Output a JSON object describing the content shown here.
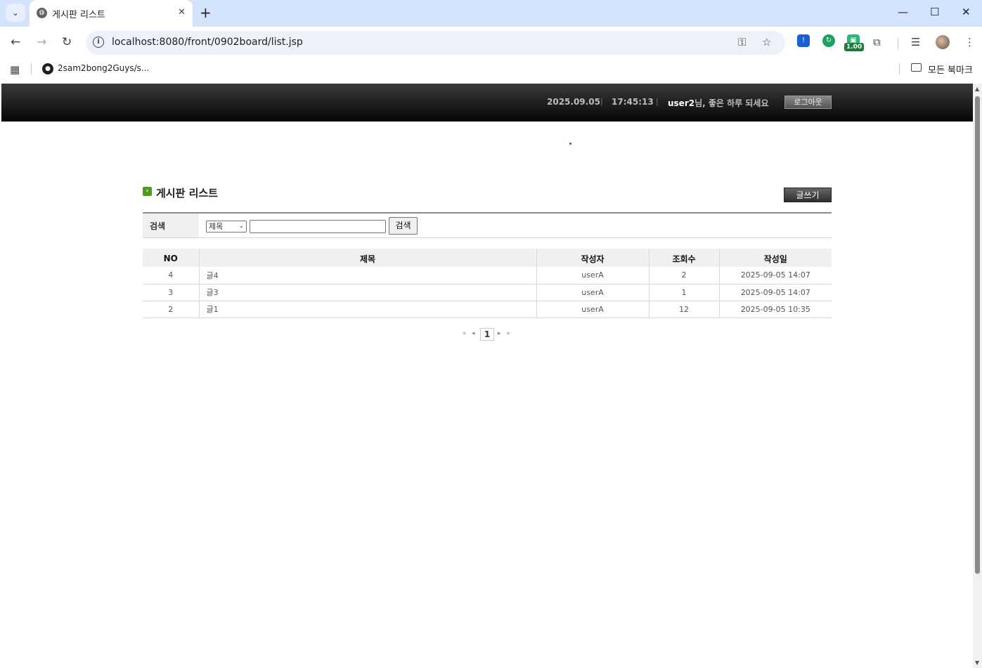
{
  "browser": {
    "tab_title": "게시판 리스트",
    "url": "localhost:8080/front/0902board/list.jsp",
    "bookmark_label": "2sam2bong2Guys/s...",
    "all_bookmarks_label": "모든 북마크",
    "extension_badge": "1.00"
  },
  "header": {
    "date": "2025.09.05",
    "time": "17:45:13",
    "username": "user2",
    "greeting": "님, 좋은 하루 되세요",
    "logout_label": "로그아웃"
  },
  "board": {
    "title": "게시판 리스트",
    "write_label": "글쓰기",
    "search": {
      "label": "검색",
      "selected_option": "제목",
      "query": "",
      "button_label": "검색"
    },
    "columns": [
      "NO",
      "제목",
      "작성자",
      "조회수",
      "작성일"
    ],
    "rows": [
      {
        "no": "4",
        "title": "글4",
        "author": "userA",
        "views": "2",
        "date": "2025-09-05 14:07"
      },
      {
        "no": "3",
        "title": "글3",
        "author": "userA",
        "views": "1",
        "date": "2025-09-05 14:07"
      },
      {
        "no": "2",
        "title": "글1",
        "author": "userA",
        "views": "12",
        "date": "2025-09-05 10:35"
      }
    ],
    "pagination": {
      "current_page": "1"
    }
  }
}
